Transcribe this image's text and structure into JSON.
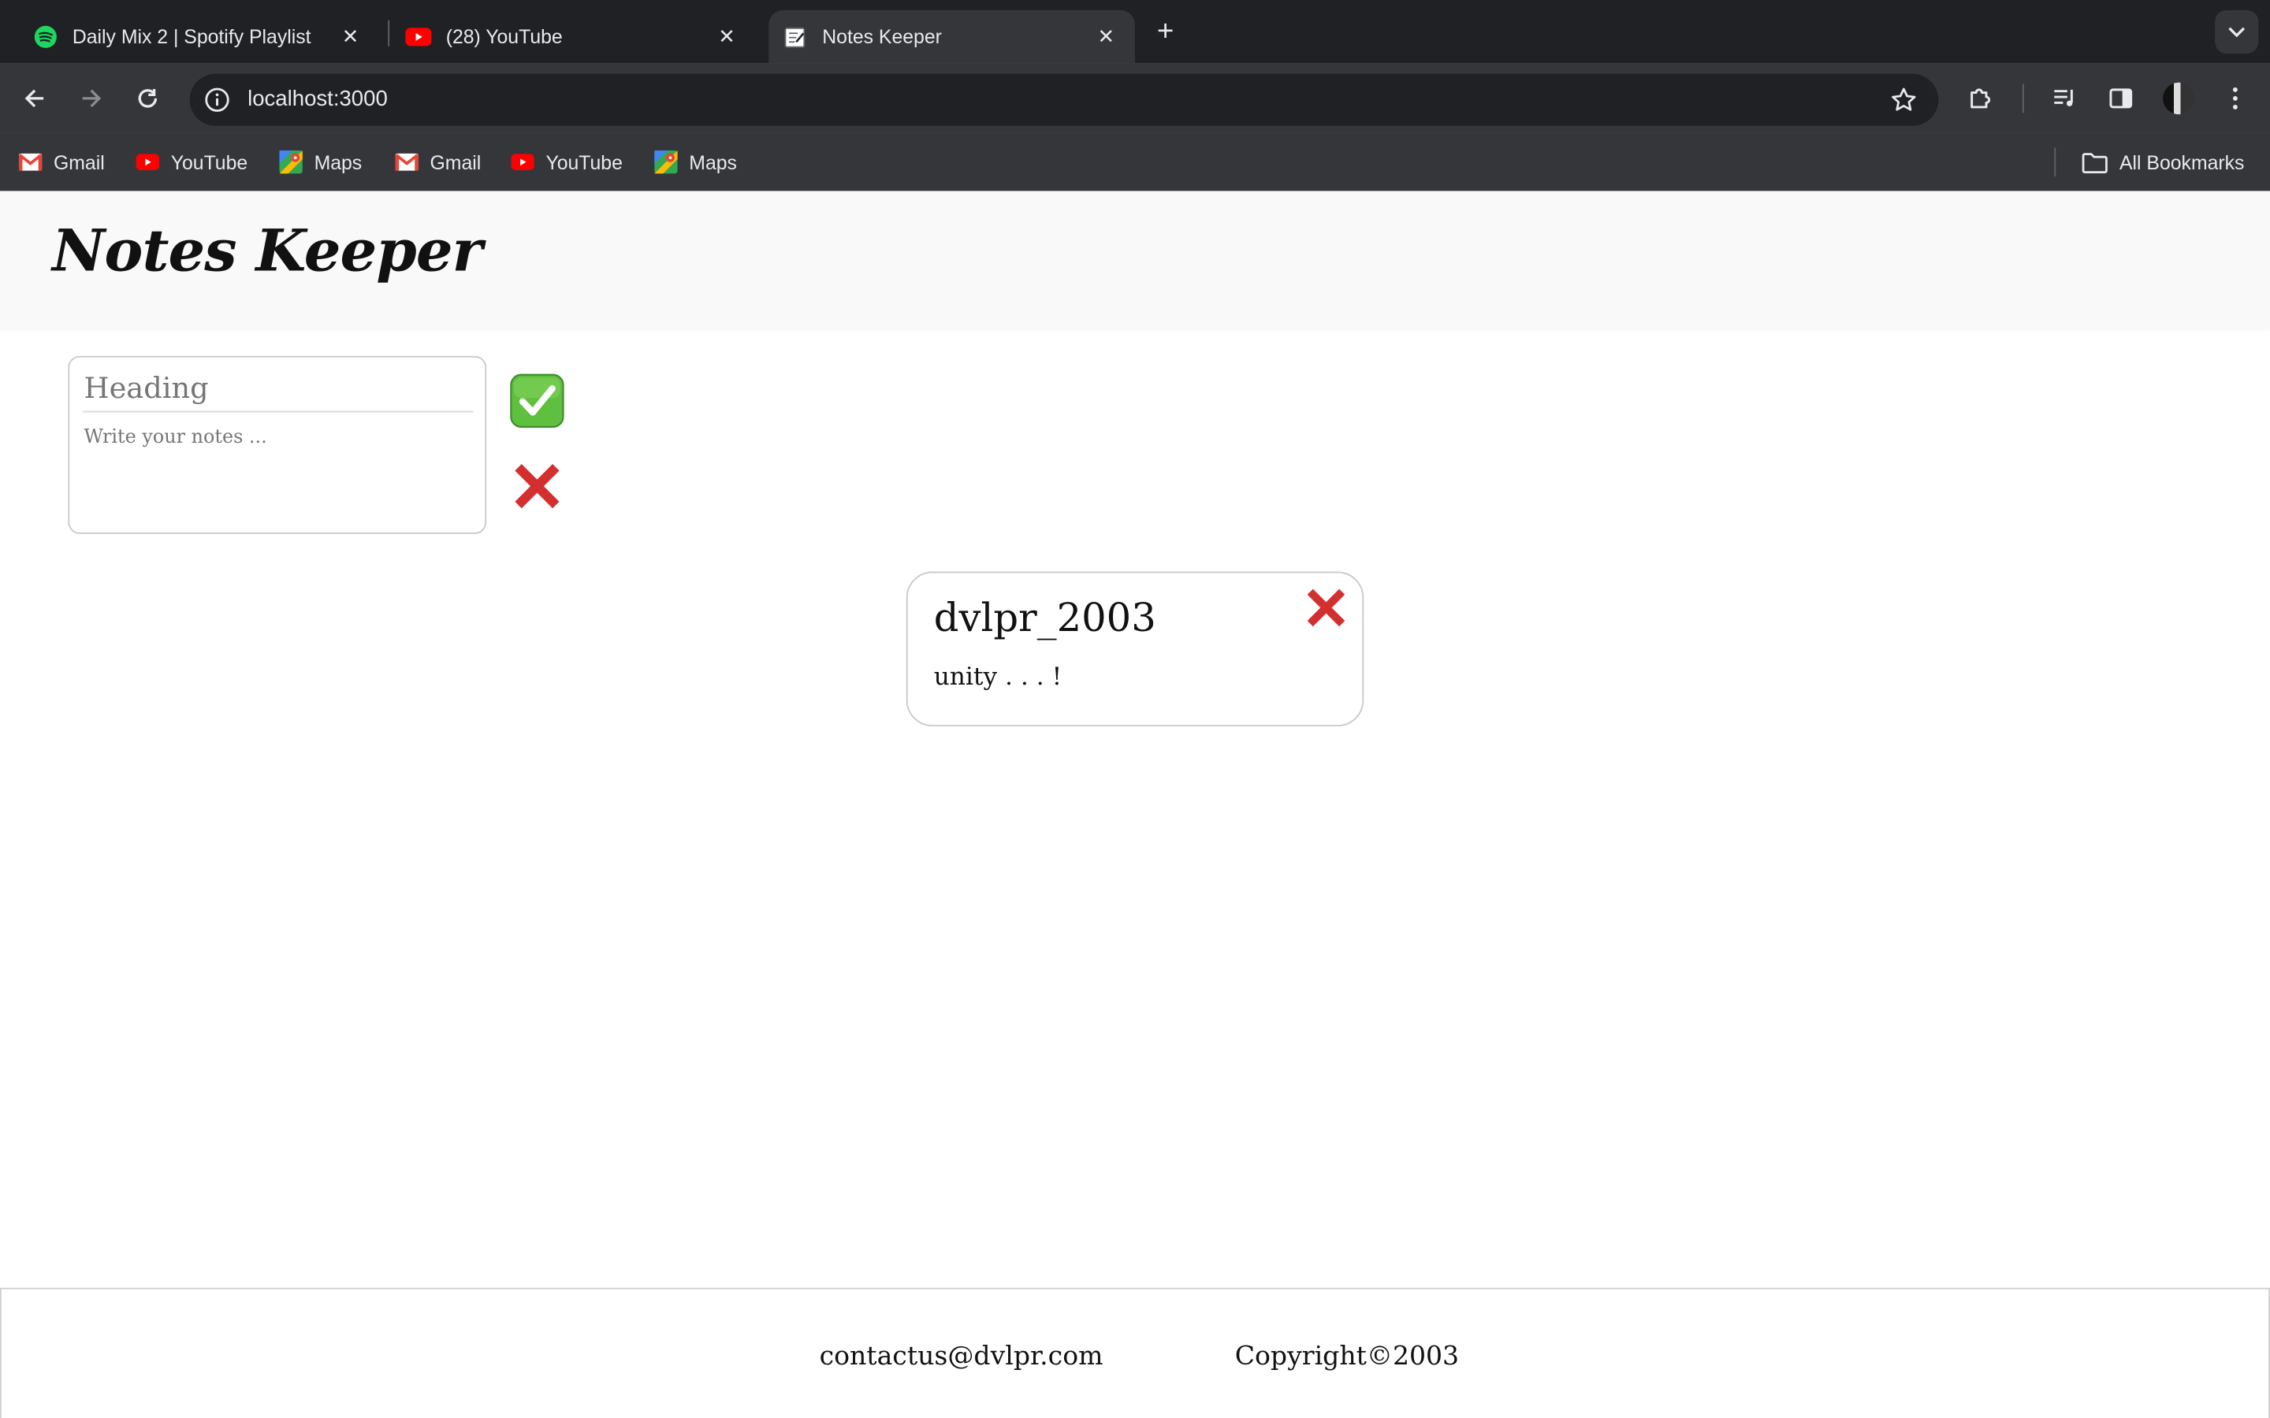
{
  "browser": {
    "tabs": [
      {
        "title": "Daily Mix 2 | Spotify Playlist",
        "icon": "spotify-icon",
        "active": false
      },
      {
        "title": "(28) YouTube",
        "icon": "youtube-icon",
        "active": false
      },
      {
        "title": "Notes Keeper",
        "icon": "notes-icon",
        "active": true
      }
    ],
    "url": "localhost:3000",
    "bookmarks": [
      {
        "label": "Gmail",
        "icon": "gmail-icon"
      },
      {
        "label": "YouTube",
        "icon": "youtube-icon"
      },
      {
        "label": "Maps",
        "icon": "maps-icon"
      },
      {
        "label": "Gmail",
        "icon": "gmail-icon"
      },
      {
        "label": "YouTube",
        "icon": "youtube-icon"
      },
      {
        "label": "Maps",
        "icon": "maps-icon"
      }
    ],
    "all_bookmarks_label": "All Bookmarks"
  },
  "app": {
    "title": "Notes Keeper",
    "composer": {
      "heading_placeholder": "Heading",
      "notes_placeholder": "Write your notes ...",
      "heading_value": "",
      "notes_value": ""
    },
    "notes": [
      {
        "title": "dvlpr_2003",
        "body": "unity . . . !"
      }
    ],
    "footer": {
      "email": "contactus@dvlpr.com",
      "copyright": "Copyright©2003"
    }
  },
  "colors": {
    "browser_frame": "#202124",
    "toolbar": "#35363a",
    "header_bg": "#f9f9f9",
    "check_green": "#4caf50",
    "cross_red": "#d32f2f"
  }
}
